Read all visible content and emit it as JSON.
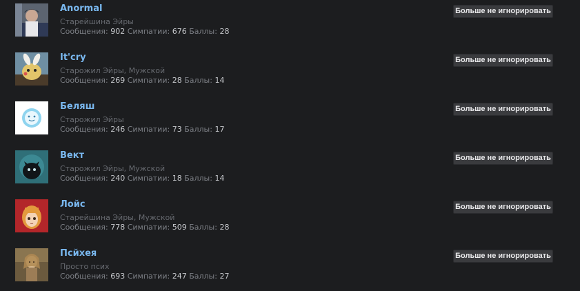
{
  "labels": {
    "messages": "Сообщения:",
    "likes": "Симпатии:",
    "points": "Баллы:",
    "unignore_button": "Больше не игнорировать"
  },
  "users": [
    {
      "name": "Anormal",
      "title": "Старейшина Эйры",
      "gender": "",
      "messages": "902",
      "likes": "676",
      "points": "28"
    },
    {
      "name": "It'cry",
      "title": "Старожил Эйры",
      "gender": "Мужской",
      "messages": "269",
      "likes": "28",
      "points": "14"
    },
    {
      "name": "Беляш",
      "title": "Старожил Эйры",
      "gender": "",
      "messages": "246",
      "likes": "73",
      "points": "17"
    },
    {
      "name": "Вект",
      "title": "Старожил Эйры",
      "gender": "Мужской",
      "messages": "240",
      "likes": "18",
      "points": "14"
    },
    {
      "name": "Лойс",
      "title": "Старейшина Эйры",
      "gender": "Мужской",
      "messages": "778",
      "likes": "509",
      "points": "28"
    },
    {
      "name": "Псйхея",
      "title": "Просто псих",
      "gender": "",
      "messages": "693",
      "likes": "247",
      "points": "27"
    }
  ]
}
